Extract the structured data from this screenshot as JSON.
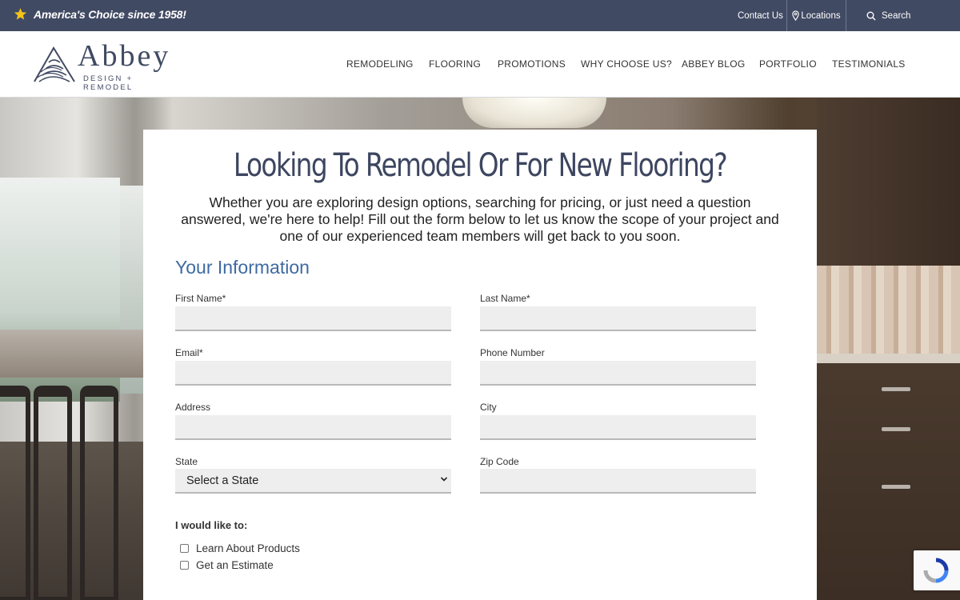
{
  "topbar": {
    "tagline": "America's Choice since 1958!",
    "contact": "Contact Us",
    "locations": "Locations",
    "search": "Search"
  },
  "header": {
    "logo_word": "Abbey",
    "logo_sub": "DESIGN + REMODEL",
    "nav": [
      "REMODELING",
      "FLOORING",
      "PROMOTIONS",
      "WHY CHOOSE US?",
      "ABBEY BLOG",
      "PORTFOLIO",
      "TESTIMONIALS"
    ]
  },
  "form": {
    "heading": "Looking To Remodel Or For New Flooring?",
    "intro": "Whether you are exploring design options, searching for pricing, or just need a question answered, we're here to help! Fill out the form below to let us know the scope of your project and one of our experienced team members will get back to you soon.",
    "section_title": "Your Information",
    "fields": {
      "first_name": "First Name*",
      "last_name": "Last Name*",
      "email": "Email*",
      "phone": "Phone Number",
      "address": "Address",
      "city": "City",
      "state": "State",
      "zip": "Zip Code"
    },
    "state_selected": "Select a State",
    "would_like": "I would like to:",
    "options": [
      "Learn About Products",
      "Get an Estimate"
    ]
  },
  "colors": {
    "topbar": "#414a63",
    "heading": "#3d4660",
    "section_title": "#3e6aa1",
    "star": "#f2c31a"
  }
}
